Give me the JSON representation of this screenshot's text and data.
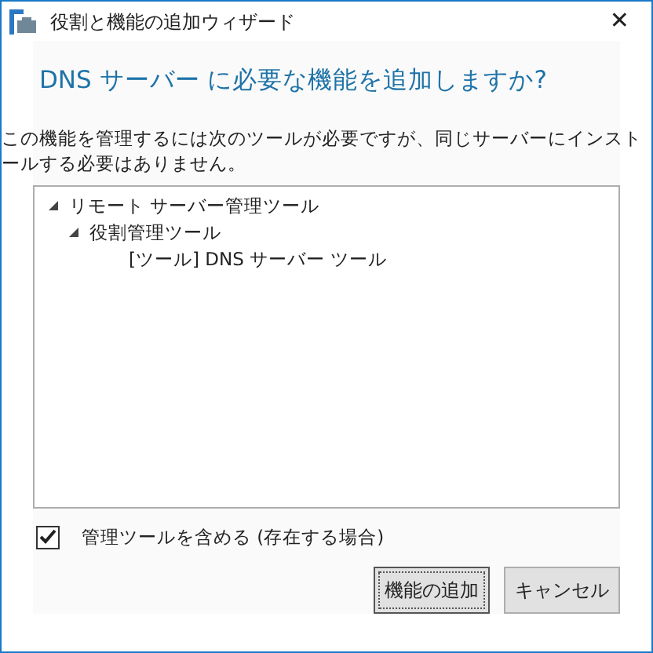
{
  "window": {
    "title": "役割と機能の追加ウィザード",
    "close": "✕"
  },
  "heading": "DNS サーバー に必要な機能を追加しますか?",
  "description": "この機能を管理するには次のツールが必要ですが、同じサーバーにインストールする必要はありません。",
  "tree": [
    {
      "label": "リモート サーバー管理ツール",
      "expanded": true,
      "children": [
        {
          "label": "役割管理ツール",
          "expanded": true,
          "children": [
            {
              "label": "[ツール] DNS サーバー ツール"
            }
          ]
        }
      ]
    }
  ],
  "include_tools": {
    "label": "管理ツールを含める (存在する場合)",
    "checked": true
  },
  "buttons": [
    {
      "label": "機能の追加",
      "focused": true
    },
    {
      "label": "キャンセル",
      "focused": false
    }
  ]
}
